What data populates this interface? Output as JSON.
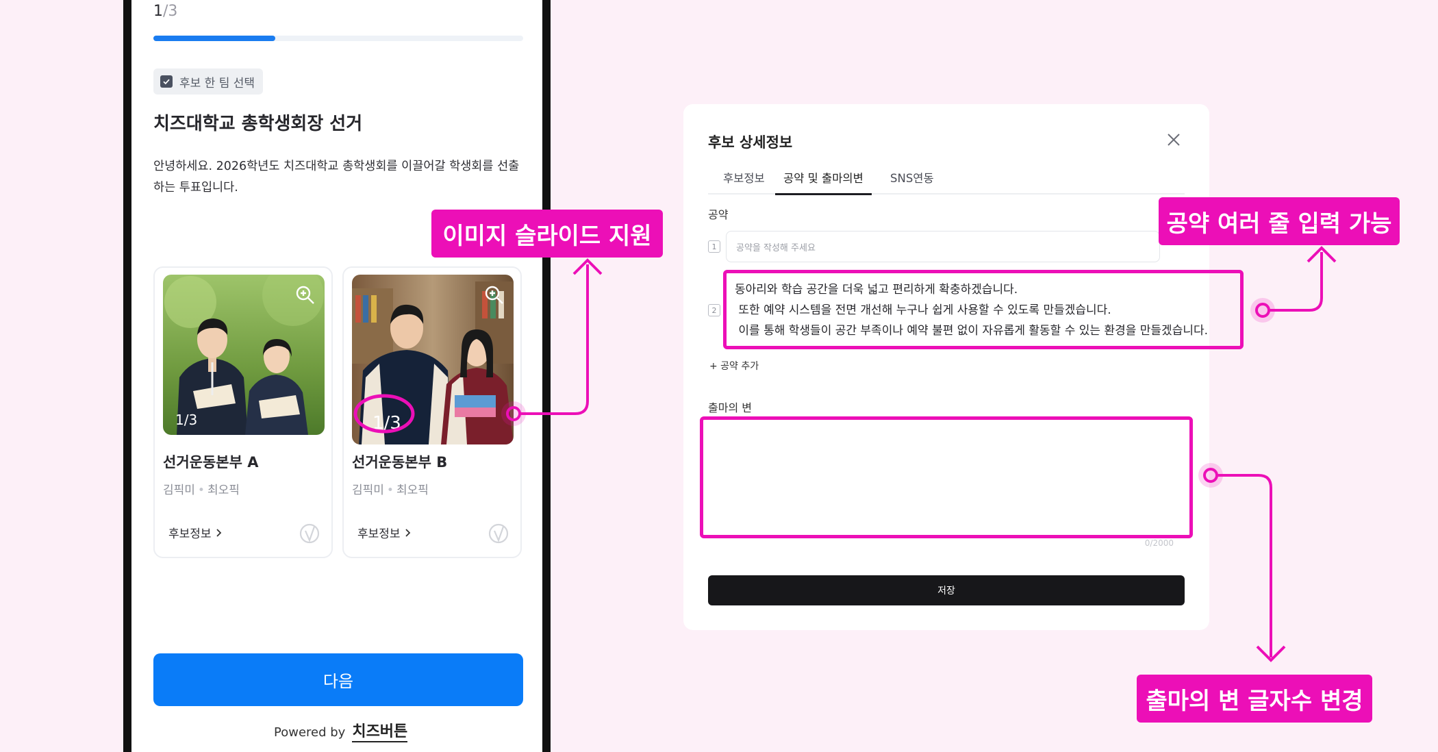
{
  "colors": {
    "background": "#fdf0f8",
    "accent_blue": "#0a7cf8",
    "callout_magenta": "#ec0fb7",
    "modal_button": "#17171a"
  },
  "phone": {
    "step": {
      "current": "1",
      "total": "/3"
    },
    "progress_fraction": 0.33,
    "team_chip_label": "후보 한 팀 선택",
    "title": "치즈대학교 총학생회장 선거",
    "description": "안녕하세요. 2026학년도 치즈대학교 총학생회를 이끌어갈 학생회를 선출하는 투표입니다.",
    "candidates": [
      {
        "slide_counter": "1/3",
        "name": "선거운동본부 A",
        "member_1": "김픽미",
        "member_2": "최오픽",
        "info_link": "후보정보",
        "icons": [
          "zoom-in-icon",
          "vote-check-icon"
        ]
      },
      {
        "slide_counter": "1/3",
        "name": "선거운동본부 B",
        "member_1": "김픽미",
        "member_2": "최오픽",
        "info_link": "후보정보",
        "icons": [
          "zoom-in-icon",
          "vote-check-icon"
        ]
      }
    ],
    "member_separator": "•",
    "next_button": "다음",
    "powered_by": "Powered by",
    "powered_brand": "치즈버튼"
  },
  "callouts": {
    "slide": "이미지 슬라이드 지원",
    "pledge": "공약 여러 줄 입력 가능",
    "speech": "출마의 변 글자수 변경"
  },
  "modal": {
    "title": "후보 상세정보",
    "close_icon": "close-icon",
    "tabs": [
      "후보정보",
      "공약 및 출마의변",
      "SNS연동"
    ],
    "active_tab": "공약 및 출마의변",
    "pledge_label": "공약",
    "pledges": [
      {
        "number": "1",
        "placeholder": "공약을 작성해 주세요"
      },
      {
        "number": "2",
        "text": "동아리와 학습 공간을 더욱 넓고 편리하게 확충하겠습니다.\n 또한 예약 시스템을 전면 개선해 누구나 쉽게 사용할 수 있도록 만들겠습니다.\n 이를 통해 학생들이 공간 부족이나 예약 불편 없이 자유롭게 활동할 수 있는 환경을 만들겠습니다."
      }
    ],
    "add_pledge": "+ 공약 추가",
    "speech_label": "출마의 변",
    "speech_value": "",
    "char_count": "0/2000",
    "save_button": "저장"
  }
}
